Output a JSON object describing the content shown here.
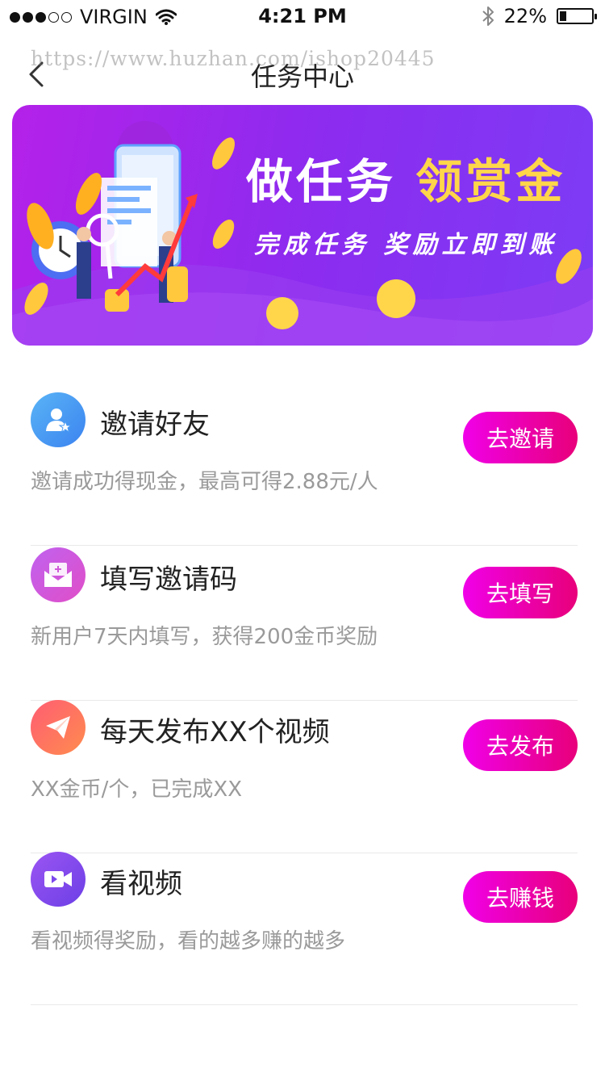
{
  "status_bar": {
    "carrier": "VIRGIN",
    "time": "4:21 PM",
    "battery_percent": "22%",
    "battery_level": 0.22,
    "signal_bars_filled": 3,
    "signal_bars_total": 5
  },
  "nav": {
    "title": "任务中心",
    "back_icon": "chevron-left-icon",
    "watermark": "https://www.huzhan.com/ishop20445"
  },
  "banner": {
    "title_part1": "做任务",
    "title_part2": "领赏金",
    "subtitle": "完成任务 奖励立即到账",
    "coin_symbol": "¥",
    "colors": {
      "bg_start": "#b421e9",
      "bg_end": "#7c3cf5",
      "gold": "#ffd64a"
    }
  },
  "tasks": [
    {
      "title": "邀请好友",
      "desc": "邀请成功得现金，最高可得2.88元/人",
      "button": "去邀请",
      "icon": "user-star-icon",
      "colors": [
        "#5ab4f6",
        "#3b83f0"
      ]
    },
    {
      "title": "填写邀请码",
      "desc": "新用户7天内填写，获得200金币奖励",
      "button": "去填写",
      "icon": "envelope-icon",
      "colors": [
        "#c062f0",
        "#e04ec7"
      ]
    },
    {
      "title": "每天发布XX个视频",
      "desc": "XX金币/个，已完成XX",
      "button": "去发布",
      "icon": "paper-plane-icon",
      "colors": [
        "#ff5d73",
        "#ff8c4e"
      ]
    },
    {
      "title": "看视频",
      "desc": "看视频得奖励，看的越多赚的越多",
      "button": "去赚钱",
      "icon": "video-camera-icon",
      "colors": [
        "#9b55f2",
        "#6c3fe6"
      ]
    }
  ],
  "accent": {
    "button_start": "#f000e8",
    "button_end": "#e8007a"
  }
}
